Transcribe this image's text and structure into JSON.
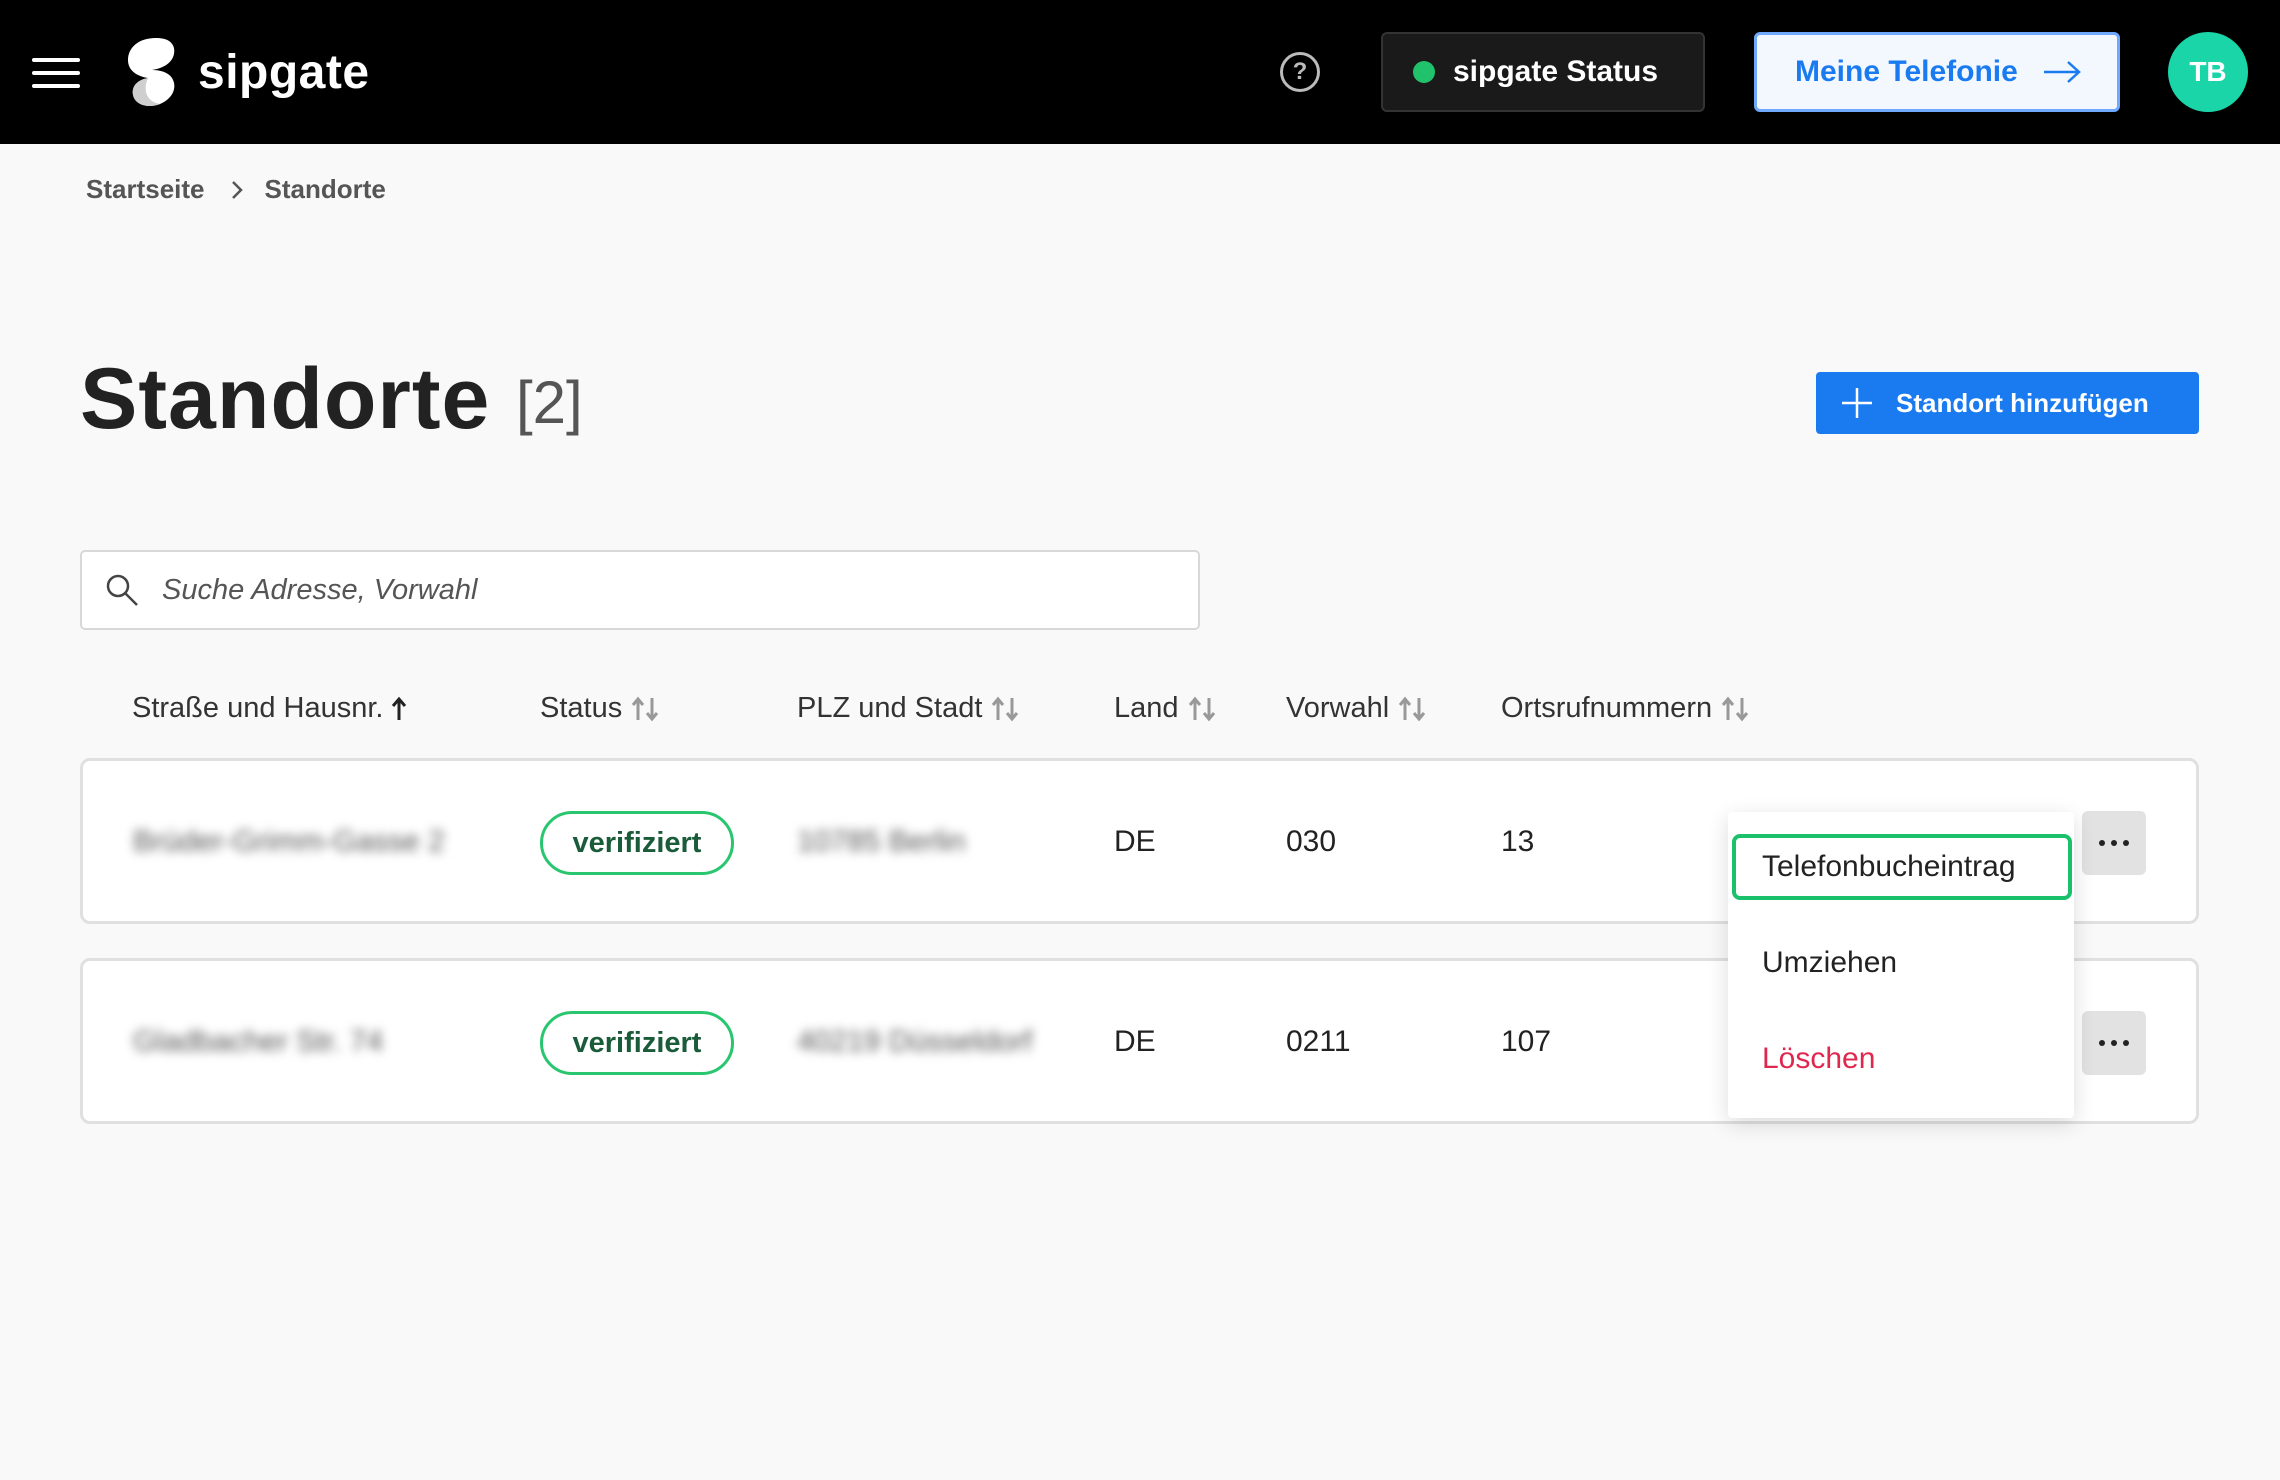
{
  "header": {
    "logo_text": "sipgate",
    "status_label": "sipgate Status",
    "status_color": "#20c36b",
    "telefonie_label": "Meine Telefonie",
    "avatar_initials": "TB",
    "avatar_color": "#19d5a8"
  },
  "breadcrumb": {
    "items": [
      "Startseite",
      "Standorte"
    ]
  },
  "page": {
    "title": "Standorte",
    "count": "[2]",
    "add_button_label": "Standort hinzufügen"
  },
  "search": {
    "placeholder": "Suche Adresse, Vorwahl",
    "value": ""
  },
  "table": {
    "columns": [
      "Straße und Hausnr.",
      "Status",
      "PLZ und Stadt",
      "Land",
      "Vorwahl",
      "Ortsrufnummern"
    ],
    "rows": [
      {
        "street": "Brüder-Grimm-Gasse 2",
        "status": "verifiziert",
        "city": "10785 Berlin",
        "country": "DE",
        "area_code": "030",
        "numbers": "13"
      },
      {
        "street": "Gladbacher Str. 74",
        "status": "verifiziert",
        "city": "40219 Düsseldorf",
        "country": "DE",
        "area_code": "0211",
        "numbers": "107"
      }
    ]
  },
  "menu": {
    "items": [
      "Telefonbucheintrag",
      "Umziehen",
      "Löschen"
    ]
  },
  "colors": {
    "primary": "#1a7bf0",
    "verified": "#28c76f",
    "danger": "#e0284f",
    "focus": "#1bc16a"
  }
}
